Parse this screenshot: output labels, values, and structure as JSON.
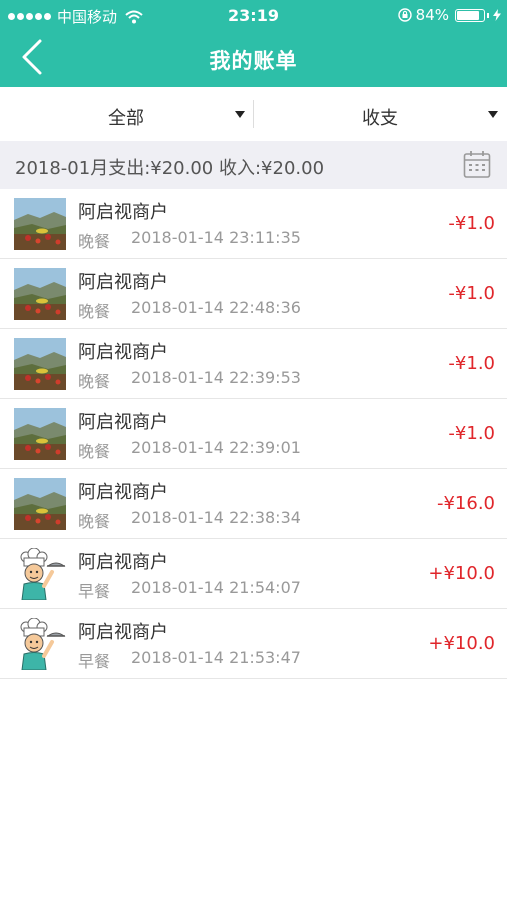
{
  "status_bar": {
    "carrier": "中国移动",
    "time": "23:19",
    "battery": "84%",
    "battery_level": 0.84
  },
  "header": {
    "title": "我的账单",
    "back_icon": "chevron-left-icon"
  },
  "filters": {
    "scope": "全部",
    "type": "收支"
  },
  "summary": {
    "text": "2018-01月支出:¥20.00  收入:¥20.00",
    "calendar_icon": "calendar-icon"
  },
  "colors": {
    "accent": "#2dbfa8",
    "amount": "#e0262b"
  },
  "transactions": [
    {
      "merchant": "阿启视商户",
      "meal": "晚餐",
      "datetime": "2018-01-14 23:11:35",
      "amount": "-¥1.0",
      "thumb": "landscape-photo"
    },
    {
      "merchant": "阿启视商户",
      "meal": "晚餐",
      "datetime": "2018-01-14 22:48:36",
      "amount": "-¥1.0",
      "thumb": "landscape-photo"
    },
    {
      "merchant": "阿启视商户",
      "meal": "晚餐",
      "datetime": "2018-01-14 22:39:53",
      "amount": "-¥1.0",
      "thumb": "landscape-photo"
    },
    {
      "merchant": "阿启视商户",
      "meal": "晚餐",
      "datetime": "2018-01-14 22:39:01",
      "amount": "-¥1.0",
      "thumb": "landscape-photo"
    },
    {
      "merchant": "阿启视商户",
      "meal": "晚餐",
      "datetime": "2018-01-14 22:38:34",
      "amount": "-¥16.0",
      "thumb": "landscape-photo"
    },
    {
      "merchant": "阿启视商户",
      "meal": "早餐",
      "datetime": "2018-01-14 21:54:07",
      "amount": "+¥10.0",
      "thumb": "chef-avatar"
    },
    {
      "merchant": "阿启视商户",
      "meal": "早餐",
      "datetime": "2018-01-14 21:53:47",
      "amount": "+¥10.0",
      "thumb": "chef-avatar"
    }
  ]
}
